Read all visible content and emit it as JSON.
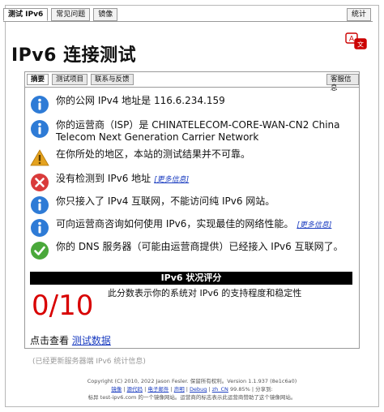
{
  "top_tabs": [
    "测试 IPv6",
    "常见问题",
    "镜像"
  ],
  "top_right_tab": "统计",
  "title": "IPv6 连接测试",
  "panel_tabs": [
    "摘要",
    "测试项目",
    "联系与反馈"
  ],
  "panel_right_tab": "客服信息",
  "results": [
    {
      "icon": "info-icon",
      "text": "你的公网 IPv4 地址是 116.6.234.159"
    },
    {
      "icon": "info-icon",
      "text": "你的运营商（ISP）是 CHINATELECOM-CORE-WAN-CN2 China Telecom Next Generation Carrier Network"
    },
    {
      "icon": "warning-icon",
      "text": "在你所处的地区，本站的测试结果并不可靠。"
    },
    {
      "icon": "error-icon",
      "text": "没有检测到 IPv6 地址",
      "more": "[更多信息]"
    },
    {
      "icon": "info-icon",
      "text": "你只接入了 IPv4 互联网，不能访问纯 IPv6 网站。"
    },
    {
      "icon": "info-icon",
      "text": "可向运营商咨询如何使用 IPv6，实现最佳的网络性能。",
      "more": "[更多信息]"
    },
    {
      "icon": "check-icon",
      "text": "你的 DNS 服务器（可能由运营商提供）已经接入 IPv6 互联网了。"
    }
  ],
  "score": {
    "header": "IPv6 状况评分",
    "value": "0/10",
    "description": "此分数表示你的系统对 IPv6 的支持程度和稳定性"
  },
  "click_prefix": "点击查看",
  "click_link": "测试数据",
  "muted_line": "(已经更新服务器端 IPv6 统计信息)",
  "footer": {
    "line1": "Copyright (C) 2010, 2022 Jason Fesler. 保留所有权利。Version 1.1.937 (8e1c6a0)",
    "line2_links": [
      "镜像",
      "源代码",
      "电子邮件",
      "声明",
      "Debug"
    ],
    "line2_locale": "zh_CN",
    "line2_rest": "99.85% | 分享到:",
    "line3": "标异 test-ipv6.com 的一个镜像网站。运营商的标志表示此运营商赞助了这个镜像网站。"
  },
  "colors": {
    "info": "#2e7bd6",
    "warning": "#e4a21f",
    "error": "#d93b3b",
    "check": "#4aa83a",
    "score_red": "#d80000",
    "link": "#1a3cc0"
  }
}
